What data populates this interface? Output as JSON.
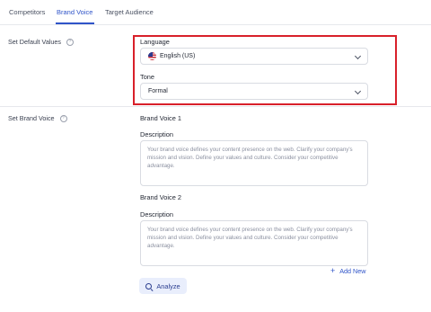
{
  "tabs": [
    {
      "label": "Competitors",
      "active": false
    },
    {
      "label": "Brand Voice",
      "active": true
    },
    {
      "label": "Target Audience",
      "active": false
    }
  ],
  "default_values": {
    "section_label": "Set Default Values",
    "help_icon": "?",
    "language_label": "Language",
    "language_value": "English (US)",
    "language_flag_icon": "us-flag-icon",
    "tone_label": "Tone",
    "tone_value": "Formal"
  },
  "brand_voice": {
    "section_label": "Set Brand Voice",
    "help_icon": "?",
    "voices": [
      {
        "title": "Brand Voice 1",
        "description_label": "Description",
        "placeholder": "Your brand voice defines your content presence on the web. Clarify your company's mission and vision. Define your values and culture. Consider your competitive advantage."
      },
      {
        "title": "Brand Voice 2",
        "description_label": "Description",
        "placeholder": "Your brand voice defines your content presence on the web. Clarify your company's mission and vision. Define your values and culture. Consider your competitive advantage."
      }
    ],
    "add_new_icon": "+",
    "add_new_label": "Add New",
    "analyze_label": "Analyze"
  },
  "colors": {
    "accent": "#2f54c8",
    "highlight_border": "#d8202a",
    "analyze_bg": "#e9eefc"
  }
}
